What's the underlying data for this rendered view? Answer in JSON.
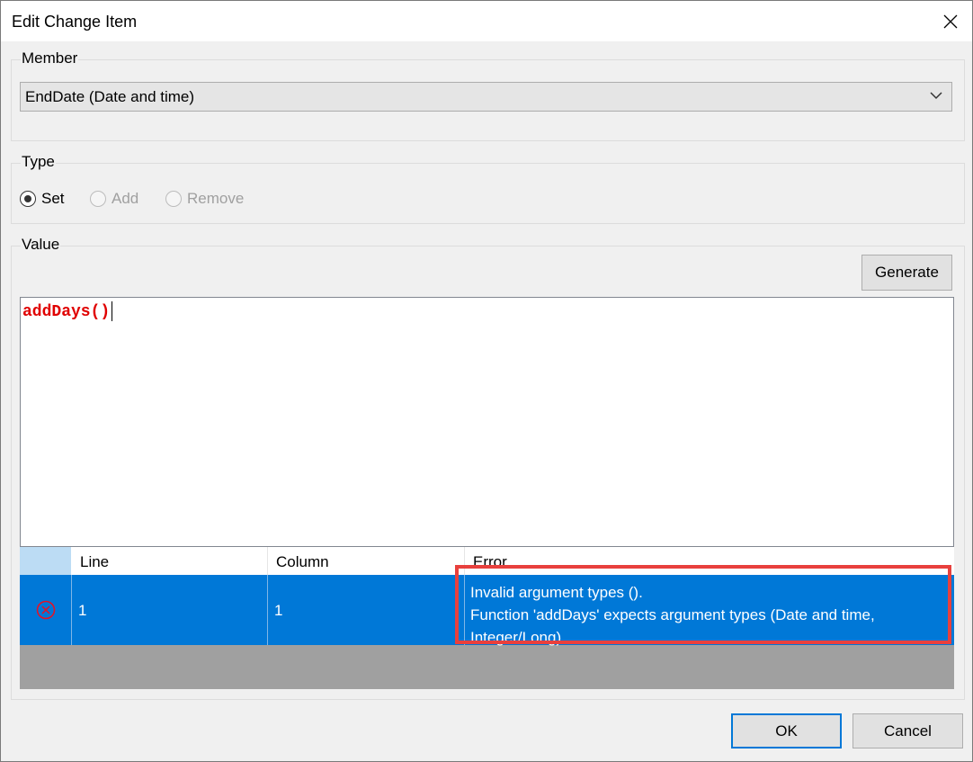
{
  "window": {
    "title": "Edit Change Item"
  },
  "member": {
    "label": "Member",
    "selected": "EndDate (Date and time)"
  },
  "type": {
    "label": "Type",
    "options": [
      {
        "label": "Set",
        "checked": true,
        "enabled": true
      },
      {
        "label": "Add",
        "checked": false,
        "enabled": false
      },
      {
        "label": "Remove",
        "checked": false,
        "enabled": false
      }
    ]
  },
  "value": {
    "label": "Value",
    "generate_label": "Generate",
    "expression": "addDays()"
  },
  "errors": {
    "columns": [
      "Line",
      "Column",
      "Error"
    ],
    "rows": [
      {
        "line": "1",
        "column": "1",
        "error_lines": [
          "Invalid argument types ().",
          "Function 'addDays' expects argument types (Date and time,",
          "Integer/Long)."
        ]
      }
    ]
  },
  "buttons": {
    "ok": "OK",
    "cancel": "Cancel"
  },
  "colors": {
    "accent": "#0078d7",
    "highlight": "#e8403d",
    "code": "#e00000"
  }
}
